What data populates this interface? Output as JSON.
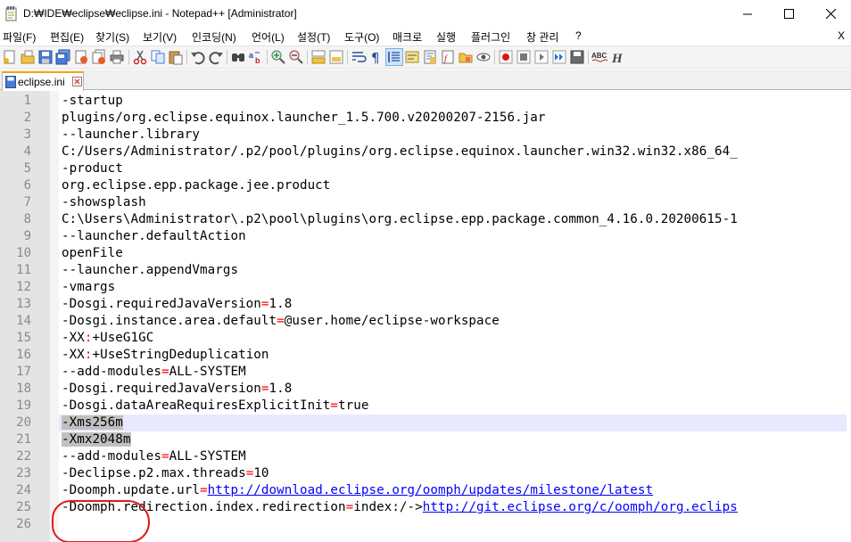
{
  "window": {
    "title": "D:\\IDE\\eclipse\\eclipse.ini - Notepad++ [Administrator]",
    "title_display": "D:₩IDE₩eclipse₩eclipse.ini - Notepad++ [Administrator]"
  },
  "menu": {
    "items": [
      "파일(F)",
      "편집(E)",
      "찾기(S)",
      "보기(V)",
      "인코딩(N)",
      "언어(L)",
      "설정(T)",
      "도구(O)",
      "매크로",
      "실행",
      "플러그인",
      "창 관리",
      "?"
    ],
    "close_label": "X"
  },
  "toolbar": {
    "icons": [
      "new-file-icon",
      "open-file-icon",
      "save-icon",
      "save-all-icon",
      "close-icon",
      "close-all-icon",
      "print-icon",
      "cut-icon",
      "copy-icon",
      "paste-icon",
      "undo-icon",
      "redo-icon",
      "find-icon",
      "replace-icon",
      "zoom-in-icon",
      "zoom-out-icon",
      "sync-vertical-icon",
      "sync-horizontal-icon",
      "word-wrap-icon",
      "show-all-chars-icon",
      "indent-guide-icon",
      "user-lang-icon",
      "doc-map-icon",
      "function-list-icon",
      "folder-workspace-icon",
      "monitoring-icon",
      "record-macro-icon",
      "stop-macro-icon",
      "play-macro-icon",
      "run-macro-multiple-icon",
      "save-macro-icon",
      "spell-check-icon",
      "hex-icon"
    ],
    "spell_label": "ABC",
    "hex_label": "H"
  },
  "tabs": [
    {
      "label": "eclipse.ini",
      "active": true
    }
  ],
  "editor": {
    "current_line": 20,
    "selected_lines": [
      20,
      21
    ],
    "lines": [
      {
        "n": "1",
        "parts": [
          {
            "t": "-startup"
          }
        ]
      },
      {
        "n": "2",
        "parts": [
          {
            "t": "plugins/org.eclipse.equinox.launcher_1.5.700.v20200207-2156.jar"
          }
        ]
      },
      {
        "n": "3",
        "parts": [
          {
            "t": "--launcher.library"
          }
        ]
      },
      {
        "n": "4",
        "parts": [
          {
            "t": "C:/Users/Administrator/.p2/pool/plugins/org.eclipse.equinox.launcher.win32.win32.x86_64_"
          }
        ]
      },
      {
        "n": "5",
        "parts": [
          {
            "t": "-product"
          }
        ]
      },
      {
        "n": "6",
        "parts": [
          {
            "t": "org.eclipse.epp.package.jee.product"
          }
        ]
      },
      {
        "n": "7",
        "parts": [
          {
            "t": "-showsplash"
          }
        ]
      },
      {
        "n": "8",
        "parts": [
          {
            "t": "C:\\Users\\Administrator\\.p2\\pool\\plugins\\org.eclipse.epp.package.common_4.16.0.20200615-1"
          }
        ]
      },
      {
        "n": "9",
        "parts": [
          {
            "t": "--launcher.defaultAction"
          }
        ]
      },
      {
        "n": "10",
        "parts": [
          {
            "t": "openFile"
          }
        ]
      },
      {
        "n": "11",
        "parts": [
          {
            "t": "--launcher.appendVmargs"
          }
        ]
      },
      {
        "n": "12",
        "parts": [
          {
            "t": "-vmargs"
          }
        ]
      },
      {
        "n": "13",
        "parts": [
          {
            "t": "-Dosgi.requiredJavaVersion"
          },
          {
            "t": "=",
            "c": "eq"
          },
          {
            "t": "1.8"
          }
        ]
      },
      {
        "n": "14",
        "parts": [
          {
            "t": "-Dosgi.instance.area.default"
          },
          {
            "t": "=",
            "c": "eq"
          },
          {
            "t": "@user.home/eclipse-workspace"
          }
        ]
      },
      {
        "n": "15",
        "parts": [
          {
            "t": "-XX"
          },
          {
            "t": ":",
            "c": "eq"
          },
          {
            "t": "+UseG1GC"
          }
        ]
      },
      {
        "n": "16",
        "parts": [
          {
            "t": "-XX"
          },
          {
            "t": ":",
            "c": "eq"
          },
          {
            "t": "+UseStringDeduplication"
          }
        ]
      },
      {
        "n": "17",
        "parts": [
          {
            "t": "--add-modules"
          },
          {
            "t": "=",
            "c": "eq"
          },
          {
            "t": "ALL-SYSTEM"
          }
        ]
      },
      {
        "n": "18",
        "parts": [
          {
            "t": "-Dosgi.requiredJavaVersion"
          },
          {
            "t": "=",
            "c": "eq"
          },
          {
            "t": "1.8"
          }
        ]
      },
      {
        "n": "19",
        "parts": [
          {
            "t": "-Dosgi.dataAreaRequiresExplicitInit"
          },
          {
            "t": "=",
            "c": "eq"
          },
          {
            "t": "true"
          }
        ]
      },
      {
        "n": "20",
        "parts": [
          {
            "t": "-Xms256m",
            "c": "sel"
          }
        ]
      },
      {
        "n": "21",
        "parts": [
          {
            "t": "-Xmx2048m",
            "c": "sel"
          }
        ]
      },
      {
        "n": "22",
        "parts": [
          {
            "t": "--add-modules"
          },
          {
            "t": "=",
            "c": "eq"
          },
          {
            "t": "ALL-SYSTEM"
          }
        ]
      },
      {
        "n": "23",
        "parts": [
          {
            "t": "-Declipse.p2.max.threads"
          },
          {
            "t": "=",
            "c": "eq"
          },
          {
            "t": "10"
          }
        ]
      },
      {
        "n": "24",
        "parts": [
          {
            "t": "-Doomph.update.url"
          },
          {
            "t": "=",
            "c": "eq"
          },
          {
            "t": "http://download.eclipse.org/oomph/updates/milestone/latest",
            "c": "url"
          }
        ]
      },
      {
        "n": "25",
        "parts": [
          {
            "t": "-Doomph.redirection.index.redirection"
          },
          {
            "t": "=",
            "c": "eq"
          },
          {
            "t": "index:/->"
          },
          {
            "t": "http://git.eclipse.org/c/oomph/org.eclips",
            "c": "url"
          }
        ]
      },
      {
        "n": "26",
        "parts": []
      }
    ]
  },
  "colors": {
    "equals": "#ff0000",
    "url": "#0000ff",
    "selection": "#c0c0c0",
    "current_line": "#e8e8ff",
    "annotation_circle": "#e01b1b",
    "active_tab_accent": "#f7a700"
  }
}
